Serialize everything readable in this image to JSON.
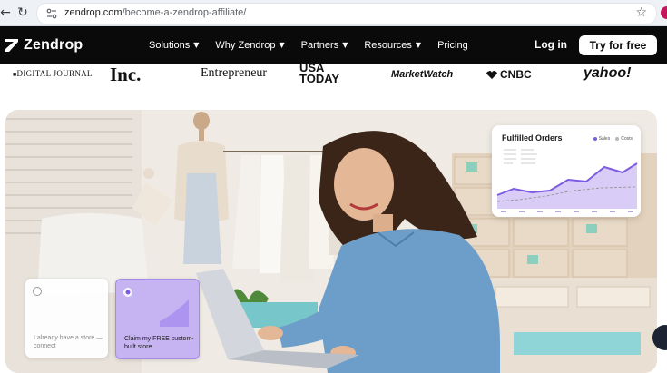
{
  "browser": {
    "url_host": "zendrop.com",
    "url_path": "/become-a-zendrop-affiliate/",
    "icons": [
      "back-icon",
      "reload-icon",
      "site-info-icon",
      "bookmark-star-icon"
    ]
  },
  "nav": {
    "logo_text": "Zendrop",
    "menu": [
      {
        "label": "Solutions",
        "has_dropdown": true
      },
      {
        "label": "Why Zendrop",
        "has_dropdown": true
      },
      {
        "label": "Partners",
        "has_dropdown": true
      },
      {
        "label": "Resources",
        "has_dropdown": true
      },
      {
        "label": "Pricing",
        "has_dropdown": false
      }
    ],
    "login_label": "Log in",
    "cta_label": "Try for free"
  },
  "press": {
    "digital_journal": "DIGITAL JOURNAL",
    "inc": "Inc.",
    "entrepreneur": "Entrepreneur",
    "usa_today_1": "USA",
    "usa_today_2": "TODAY",
    "marketwatch": "MarketWatch",
    "cnbc": "CNBC",
    "yahoo": "yahoo!"
  },
  "orders_card": {
    "title": "Fulfilled Orders",
    "legend": [
      "Sales",
      "Costs"
    ],
    "colors": {
      "sales": "#7c5ce0",
      "costs": "#b8b8b8"
    }
  },
  "options": {
    "existing_store": "I already have a store — connect",
    "free_store": "Claim my FREE custom-built store",
    "selected": "free_store"
  },
  "colors": {
    "nav_bg": "#0a0a0a",
    "accent_purple": "#7c5ce0",
    "option_selected_bg": "#c5b3f2"
  }
}
